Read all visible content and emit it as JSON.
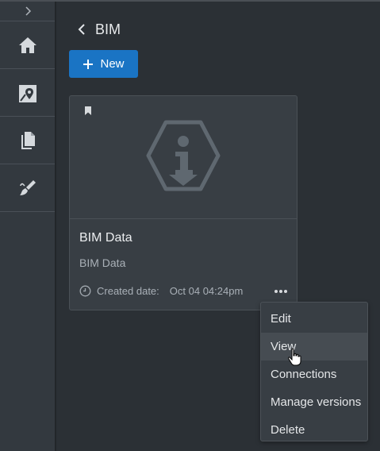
{
  "header": {
    "title": "BIM",
    "new_button_label": "New"
  },
  "sidebar": {
    "items": [
      {
        "icon": "home-icon"
      },
      {
        "icon": "map-pin-icon"
      },
      {
        "icon": "documents-icon"
      },
      {
        "icon": "brush-icon"
      }
    ]
  },
  "card": {
    "title": "BIM Data",
    "subtitle": "BIM Data",
    "created_label": "Created date:",
    "created_value": "Oct 04 04:24pm"
  },
  "menu": {
    "items": [
      "Edit",
      "View",
      "Connections",
      "Manage versions",
      "Delete"
    ],
    "hovered": "View"
  },
  "colors": {
    "accent": "#1a74c4",
    "background": "#2b3035",
    "sidebar": "#33393f",
    "card": "#383e44"
  }
}
